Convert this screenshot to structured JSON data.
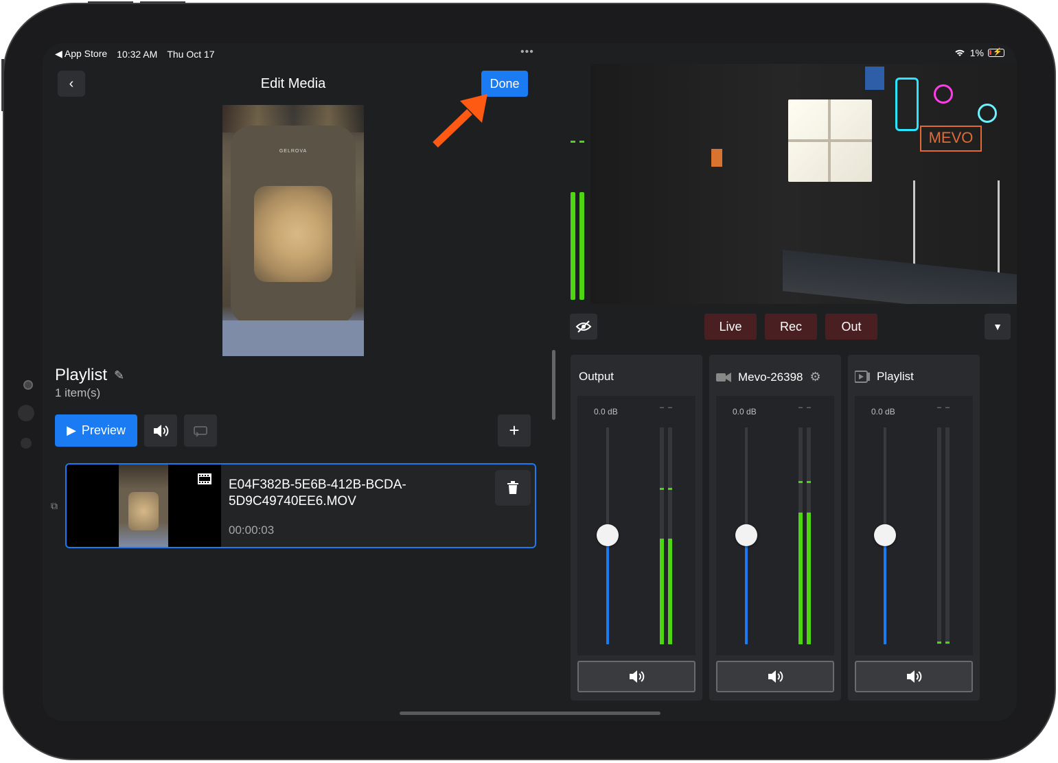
{
  "status_bar": {
    "back_app": "◀ App Store",
    "time": "10:32 AM",
    "date": "Thu Oct 17",
    "more": "•••",
    "battery": "1%"
  },
  "header": {
    "back_icon": "chevron-left-icon",
    "title": "Edit Media",
    "done_label": "Done"
  },
  "preview_image": {
    "logo_text": "GELROVA"
  },
  "playlist": {
    "title": "Playlist",
    "count": "1 item(s)",
    "preview_label": "Preview",
    "add_icon": "+",
    "items": [
      {
        "name": "E04F382B-5E6B-412B-BCDA-5D9C49740EE6.MOV",
        "duration": "00:00:03"
      }
    ]
  },
  "camera_feed": {
    "sign_text": "MEVO"
  },
  "controls": {
    "live": "Live",
    "rec": "Rec",
    "out": "Out"
  },
  "mixer": {
    "channels": [
      {
        "name": "Output",
        "level": "0.0 dB",
        "fader": 0.5
      },
      {
        "name": "Mevo-26398",
        "level": "0.0 dB",
        "fader": 0.5
      },
      {
        "name": "Playlist",
        "level": "0.0 dB",
        "fader": 0.5
      }
    ]
  },
  "colors": {
    "accent": "#1a7bf2",
    "meter": "#4ed613",
    "state_button": "#4a1f22",
    "annotation_arrow": "#ff5a14"
  }
}
